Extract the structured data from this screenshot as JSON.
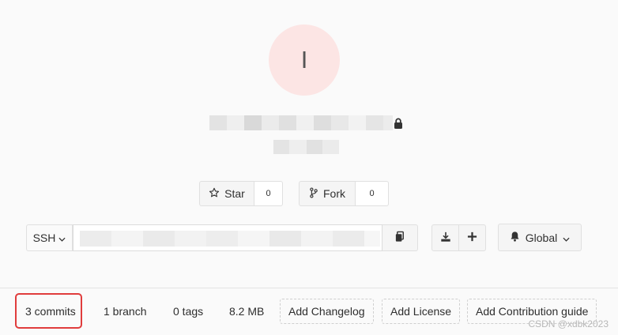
{
  "project": {
    "avatar_letter": "I"
  },
  "actions": {
    "star_label": "Star",
    "star_count": "0",
    "fork_label": "Fork",
    "fork_count": "0"
  },
  "clone": {
    "protocol": "SSH",
    "url_value": ""
  },
  "notifications": {
    "level": "Global"
  },
  "stats": {
    "commits": "3 commits",
    "branches": "1 branch",
    "tags": "0 tags",
    "size": "8.2 MB",
    "add_changelog": "Add Changelog",
    "add_license": "Add License",
    "add_contribution": "Add Contribution guide"
  },
  "watermark": "CSDN @xdbk2023",
  "icons": {
    "lock": "lock-icon",
    "star": "star-icon",
    "fork": "fork-icon",
    "copy": "copy-icon",
    "download": "download-icon",
    "plus": "plus-icon",
    "bell": "bell-icon",
    "chevron": "chevron-down-icon"
  },
  "colors": {
    "avatar_bg": "#fce5e4",
    "highlight_border": "#e03c3c",
    "page_bg": "#fafafa"
  }
}
